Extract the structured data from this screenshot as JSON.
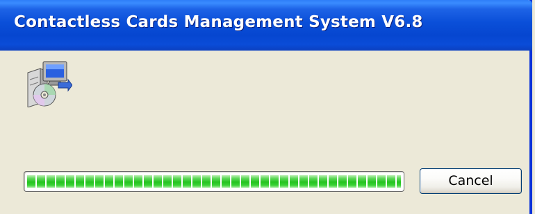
{
  "window": {
    "title": "Contactless Cards Management System V6.8"
  },
  "icon": {
    "name": "setup-installer-icon"
  },
  "progress": {
    "fraction": 1.0
  },
  "buttons": {
    "cancel_label": "Cancel"
  },
  "colors": {
    "titlebar": "#0a4fd8",
    "window_bg": "#ece9d8",
    "progress_green": "#25c320"
  }
}
